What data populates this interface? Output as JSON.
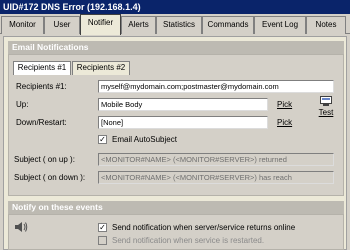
{
  "window": {
    "title": "UID#172 DNS Error (192.168.1.4)"
  },
  "tabs": [
    {
      "label": "Monitor"
    },
    {
      "label": "User"
    },
    {
      "label": "Notifier",
      "active": true
    },
    {
      "label": "Alerts"
    },
    {
      "label": "Statistics"
    },
    {
      "label": "Commands"
    },
    {
      "label": "Event Log"
    },
    {
      "label": "Notes"
    }
  ],
  "email_section": {
    "header": "Email Notifications",
    "recipient_tabs": [
      {
        "label": "Recipients #1",
        "active": true
      },
      {
        "label": "Recipients #2"
      }
    ],
    "fields": {
      "recipients_label": "Recipients #1:",
      "recipients_value": "myself@mydomain.com;postmaster@mydomain.com",
      "up_label": "Up:",
      "up_value": "Mobile Body",
      "up_pick": "Pick",
      "down_label": "Down/Restart:",
      "down_value": "[None]",
      "down_pick": "Pick",
      "test_label": "Test",
      "autosubject_label": "Email AutoSubject",
      "autosubject_checked": true,
      "subject_up_label": "Subject ( on up ):",
      "subject_up_value": "<MONITOR#NAME> (<MONITOR#SERVER>) returned",
      "subject_down_label": "Subject ( on down ):",
      "subject_down_value": "<MONITOR#NAME> (<MONITOR#SERVER>) has reach"
    }
  },
  "notify_section": {
    "header": "Notify on these events",
    "options": [
      {
        "label": "Send notification when server/service returns online",
        "checked": true,
        "enabled": true
      },
      {
        "label": "Send notification when service is restarted.",
        "checked": false,
        "enabled": false
      }
    ]
  },
  "colors": {
    "titlebar": "#0a246a",
    "panel": "#ece9d8",
    "group_header": "#bdbab2"
  }
}
